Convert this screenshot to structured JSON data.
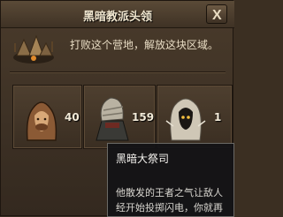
{
  "window": {
    "title": "黑暗教派头领",
    "close_label": "X"
  },
  "camp": {
    "description": "打败这个营地，解放这块区域。"
  },
  "units": [
    {
      "name": "hooded-bandit",
      "count": "40"
    },
    {
      "name": "wrapped-warrior",
      "count": "159"
    },
    {
      "name": "dark-priest",
      "count": "1"
    }
  ],
  "tooltip": {
    "name": "黑暗大祭司",
    "lines": [
      "他散发的王者之气让敌人",
      "经开始投掷闪电，你就再"
    ]
  },
  "colors": {
    "panel_bg": "#3d3125",
    "title_text": "#f0e6cf",
    "tooltip_bg": "#121216"
  }
}
